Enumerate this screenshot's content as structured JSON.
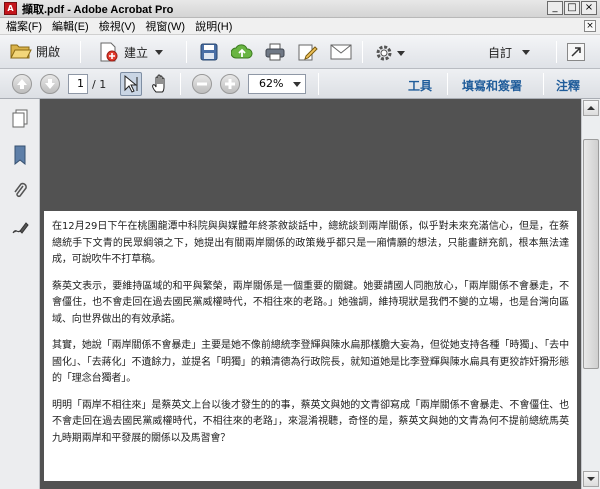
{
  "window": {
    "title": "擷取.pdf - Adobe Acrobat Pro",
    "min_glyph": "_",
    "max_glyph": "□",
    "close_glyph": "×"
  },
  "menu": {
    "items": [
      "檔案(F)",
      "編輯(E)",
      "檢視(V)",
      "視窗(W)",
      "說明(H)"
    ],
    "close_glyph": "×"
  },
  "toolbar": {
    "open_label": "開啟",
    "create_label": "建立",
    "customize_label": "自訂",
    "icons": [
      "folder-open-icon",
      "create-pdf-icon",
      "save-icon",
      "upload-icon",
      "print-icon",
      "edit-icon",
      "email-icon",
      "gear-icon",
      "expand-icon"
    ]
  },
  "nav": {
    "page_current": "1",
    "page_total": "/ 1",
    "zoom": "62%",
    "tools_label": "工具",
    "fill_sign_label": "填寫和簽署",
    "comment_label": "注釋"
  },
  "document": {
    "paragraphs": [
      "在12月29日下午在桃園龍潭中科院與與媒體年終茶敘談話中，總統談到兩岸關係，似乎對未來充滿信心，但是，在蔡總統手下文青的民眾綱領之下，她提出有關兩岸關係的政策幾乎都只是一廂情願的想法，只能畫餅充飢，根本無法達成，可說吹牛不打草稿。",
      "蔡英文表示，要維持區域的和平與繁榮，兩岸關係是一個重要的關鍵。她要請國人同胞放心，「兩岸關係不會暴走，不會僵住，也不會走回在過去國民黨威權時代，不相往來的老路。」她強調，維持現狀是我們不變的立場，也是台灣向區域、向世界做出的有效承諾。",
      "其實，她說「兩岸關係不會暴走」主要是她不像前總統李登輝與陳水扁那樣膽大妄為，但從她支持各種「時獨」、「去中國化」、「去蔣化」不遺餘力，並提名「明獨」的賴清德為行政院長，就知道她是比李登輝與陳水扁具有更狡詐奸猾形態的「理念台獨者」。",
      "明明「兩岸不相往來」是蔡英文上台以後才發生的的事，蔡英文與她的文青卻寫成「兩岸關係不會暴走、不會僵住、也不會走回在過去國民黨威權時代，不相往來的老路」，來混淆視聽，奇怪的是，蔡英文與她的文青為何不提前總統馬英九時期兩岸和平發展的關係以及馬習會？"
    ]
  }
}
